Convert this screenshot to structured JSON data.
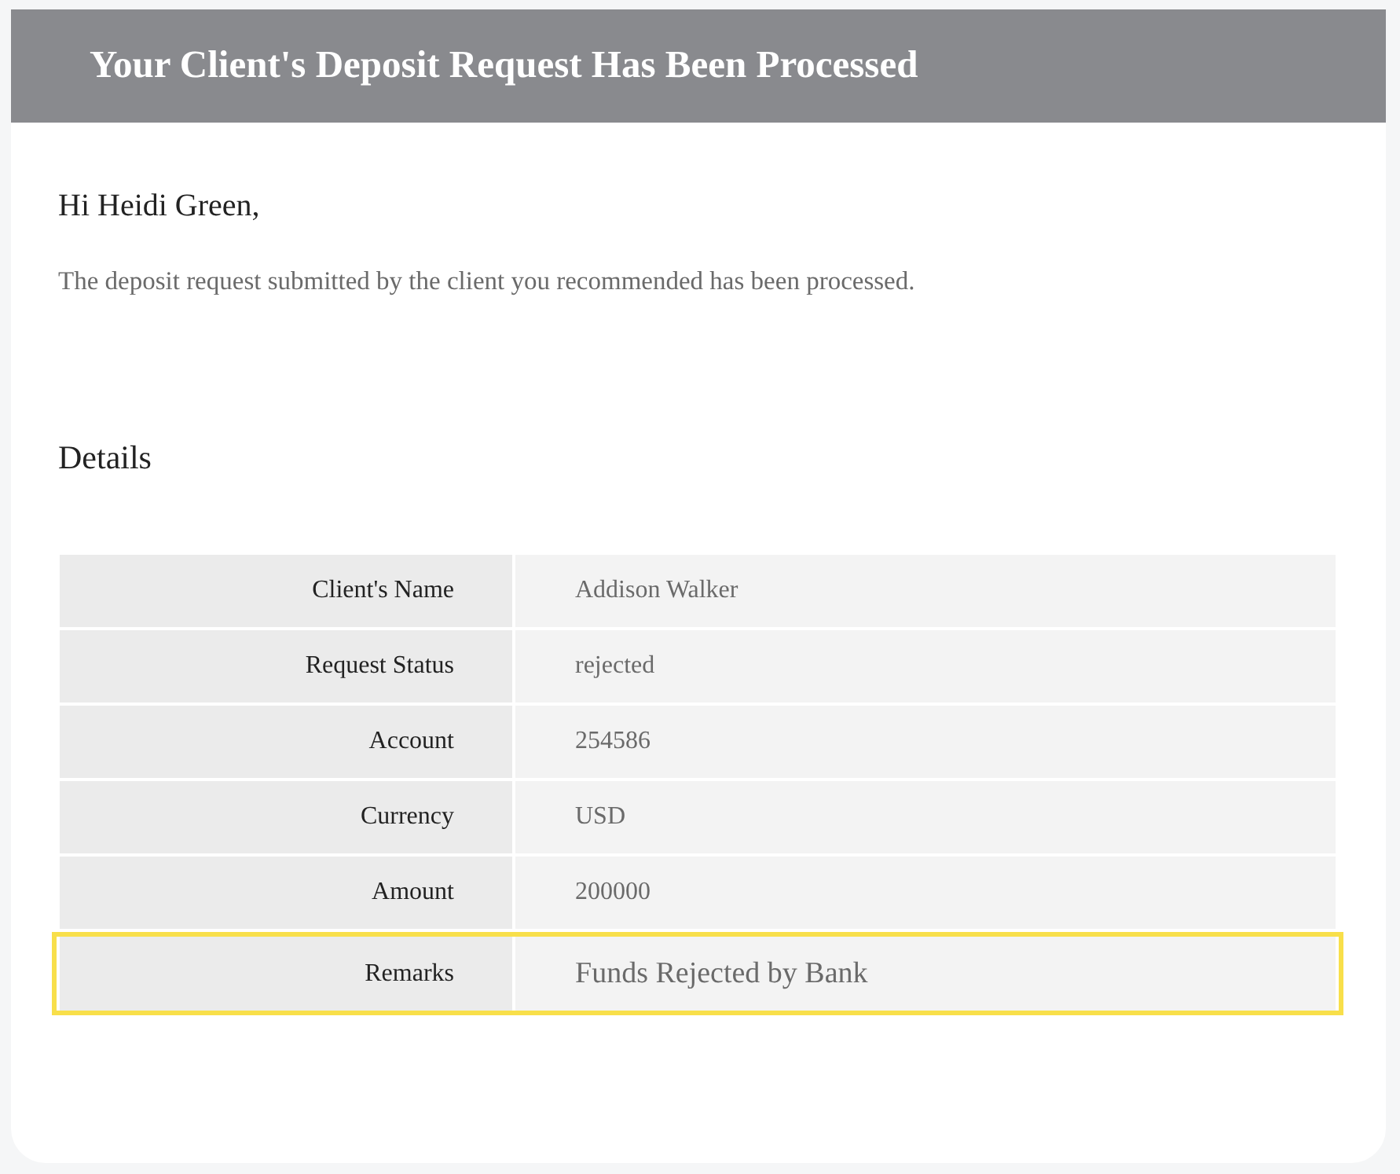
{
  "header": {
    "title": "Your Client's Deposit Request Has Been Processed"
  },
  "greeting": "Hi Heidi Green,",
  "message": "The deposit request submitted by the client you recommended has been processed.",
  "details": {
    "heading": "Details",
    "rows": [
      {
        "label": "Client's Name",
        "value": "Addison Walker",
        "highlighted": false
      },
      {
        "label": "Request Status",
        "value": "rejected",
        "highlighted": false
      },
      {
        "label": "Account",
        "value": "254586",
        "highlighted": false
      },
      {
        "label": "Currency",
        "value": "USD",
        "highlighted": false
      },
      {
        "label": "Amount",
        "value": "200000",
        "highlighted": false
      },
      {
        "label": "Remarks",
        "value": "Funds Rejected by Bank",
        "highlighted": true
      }
    ]
  }
}
